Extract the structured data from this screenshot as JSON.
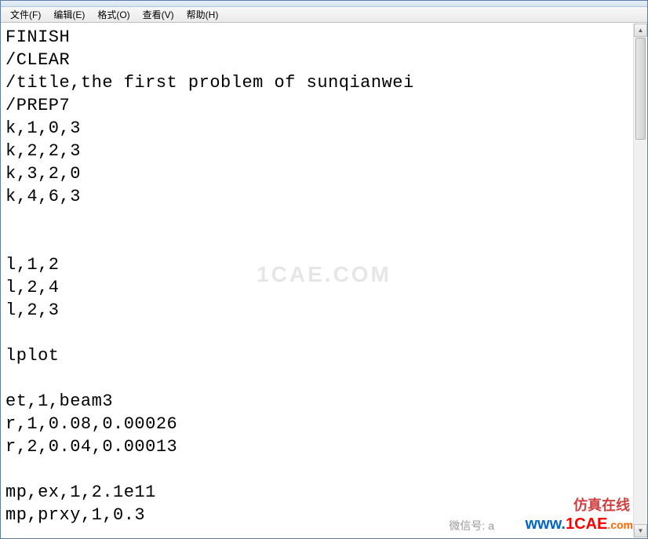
{
  "menu": {
    "file": "文件(F)",
    "edit": "编辑(E)",
    "format": "格式(O)",
    "view": "查看(V)",
    "help": "帮助(H)"
  },
  "editor": {
    "content": "FINISH\n/CLEAR\n/title,the first problem of sunqianwei\n/PREP7\nk,1,0,3\nk,2,2,3\nk,3,2,0\nk,4,6,3\n\n\nl,1,2\nl,2,4\nl,2,3\n\nlplot\n\net,1,beam3\nr,1,0.08,0.00026\nr,2,0.04,0.00013\n\nmp,ex,1,2.1e11\nmp,prxy,1,0.3"
  },
  "watermark": {
    "center": "1CAE.COM",
    "cn": "仿真在线",
    "wx": "微信号: a",
    "logo_w": "www.",
    "logo_main": "1CAE",
    "logo_suffix": ".com"
  },
  "scroll": {
    "up_glyph": "▲",
    "down_glyph": "▼"
  }
}
